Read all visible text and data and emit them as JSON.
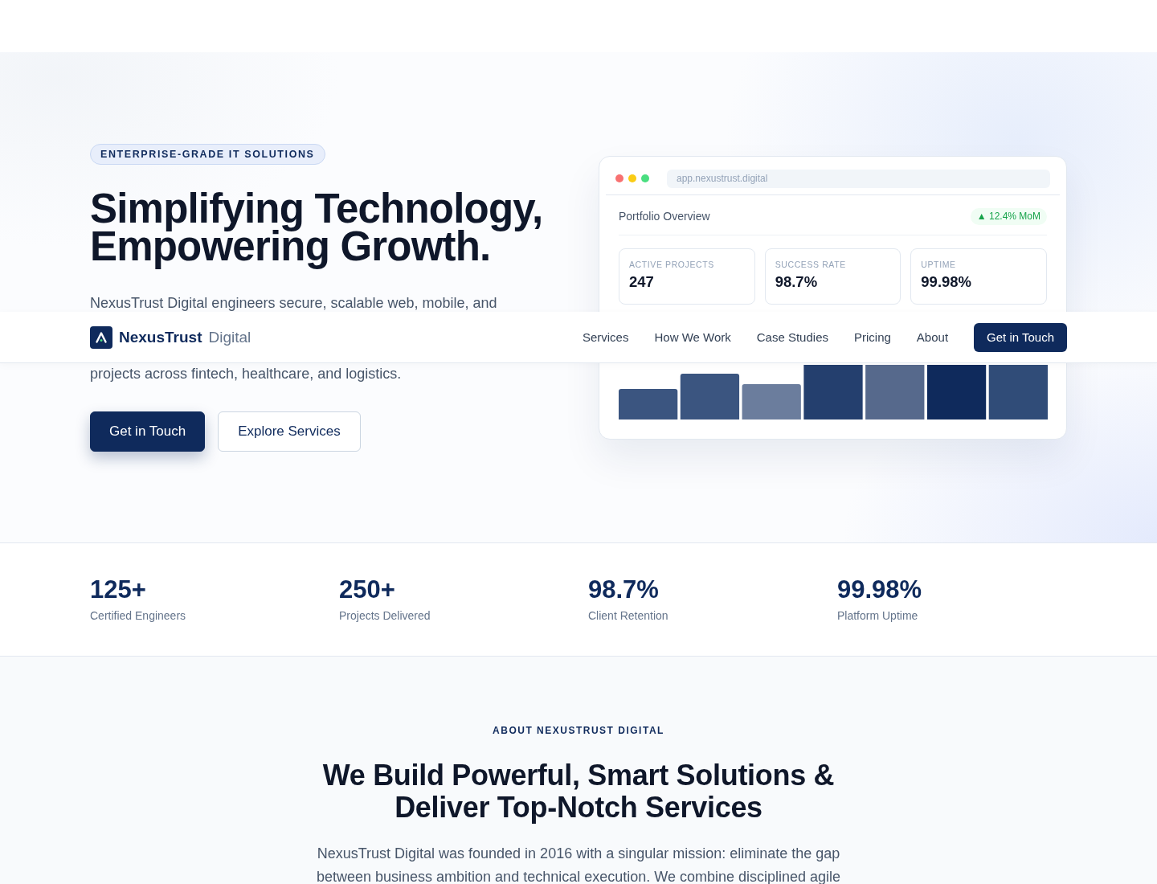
{
  "navbar": {
    "brand": "NexusTrust",
    "brand_suffix": "Digital",
    "links": [
      "Services",
      "How We Work",
      "Case Studies",
      "Pricing",
      "About"
    ],
    "cta": "Get in Touch"
  },
  "hero": {
    "badge": "ENTERPRISE-GRADE IT SOLUTIONS",
    "heading": "Simplifying Technology, Empowering Growth.",
    "intro_visible_parts": [
      "NexusTrust Digital engineers secure, scalable web, mobile, and",
      "projects across fintech, healthcare, and logistics."
    ],
    "buttons": [
      {
        "label": "Get in Touch",
        "kind": "primary"
      },
      {
        "label": "Explore Services",
        "kind": "outline"
      }
    ]
  },
  "dashboard": {
    "address": "app.nexustrust.digital",
    "title": "Portfolio Overview",
    "trend": "▲ 12.4% MoM",
    "metrics": [
      {
        "label": "ACTIVE PROJECTS",
        "value": "247"
      },
      {
        "label": "SUCCESS RATE",
        "value": "98.7%"
      },
      {
        "label": "UPTIME",
        "value": "99.98%"
      }
    ]
  },
  "stats": [
    {
      "value": "125+",
      "label": "Certified Engineers"
    },
    {
      "value": "250+",
      "label": "Projects Delivered"
    },
    {
      "value": "98.7%",
      "label": "Client Retention"
    },
    {
      "value": "99.98%",
      "label": "Platform Uptime"
    }
  ],
  "about": {
    "eyebrow": "ABOUT NEXUSTRUST DIGITAL",
    "heading": "We Build Powerful, Smart Solutions & Deliver Top-Notch Services",
    "text": "NexusTrust Digital was founded in 2016 with a singular mission: eliminate the gap between business ambition and technical execution. We combine disciplined agile"
  }
}
